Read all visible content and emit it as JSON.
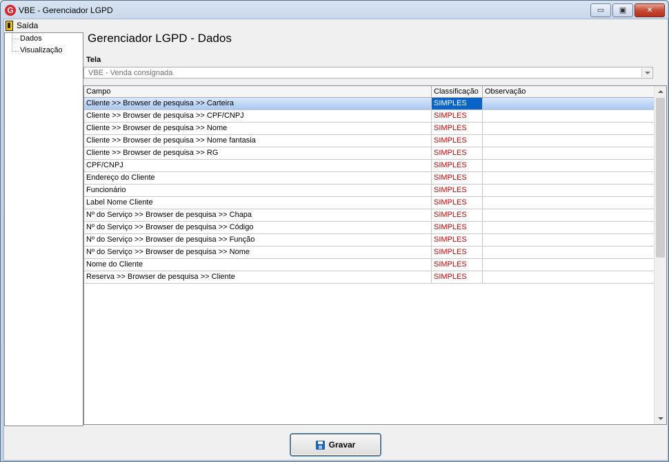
{
  "window": {
    "title": "VBE - Gerenciador LGPD",
    "logo_letter": "G",
    "buttons": {
      "minimize": "▭",
      "maximize": "▣",
      "close": "✕"
    }
  },
  "menu": {
    "exit_label": "Saída"
  },
  "tree": {
    "items": [
      "Dados",
      "Visualização"
    ]
  },
  "page": {
    "title": "Gerenciador LGPD - Dados",
    "tela_label": "Tela",
    "tela_value": "VBE - Venda consignada"
  },
  "grid": {
    "columns": [
      "Campo",
      "Classificação",
      "Observação"
    ],
    "rows": [
      {
        "campo": "Cliente >> Browser de pesquisa >> Carteira",
        "classificacao": "SIMPLES",
        "observacao": ""
      },
      {
        "campo": "Cliente >> Browser de pesquisa >> CPF/CNPJ",
        "classificacao": "SIMPLES",
        "observacao": ""
      },
      {
        "campo": "Cliente >> Browser de pesquisa >> Nome",
        "classificacao": "SIMPLES",
        "observacao": ""
      },
      {
        "campo": "Cliente >> Browser de pesquisa >> Nome fantasia",
        "classificacao": "SIMPLES",
        "observacao": ""
      },
      {
        "campo": "Cliente >> Browser de pesquisa >> RG",
        "classificacao": "SIMPLES",
        "observacao": ""
      },
      {
        "campo": "CPF/CNPJ",
        "classificacao": "SIMPLES",
        "observacao": ""
      },
      {
        "campo": "Endereço do Cliente",
        "classificacao": "SIMPLES",
        "observacao": ""
      },
      {
        "campo": "Funcionário",
        "classificacao": "SIMPLES",
        "observacao": ""
      },
      {
        "campo": "Label Nome Cliente",
        "classificacao": "SIMPLES",
        "observacao": ""
      },
      {
        "campo": "Nº do Serviço >> Browser de pesquisa >> Chapa",
        "classificacao": "SIMPLES",
        "observacao": ""
      },
      {
        "campo": "Nº do Serviço >> Browser de pesquisa >> Código",
        "classificacao": "SIMPLES",
        "observacao": ""
      },
      {
        "campo": "Nº do Serviço >> Browser de pesquisa >> Função",
        "classificacao": "SIMPLES",
        "observacao": ""
      },
      {
        "campo": "Nº do Serviço >> Browser de pesquisa >> Nome",
        "classificacao": "SIMPLES",
        "observacao": ""
      },
      {
        "campo": "Nome do Cliente",
        "classificacao": "SIMPLES",
        "observacao": ""
      },
      {
        "campo": "Reserva >> Browser de pesquisa >> Cliente",
        "classificacao": "SIMPLES",
        "observacao": ""
      }
    ]
  },
  "actions": {
    "save_label": "Gravar"
  }
}
